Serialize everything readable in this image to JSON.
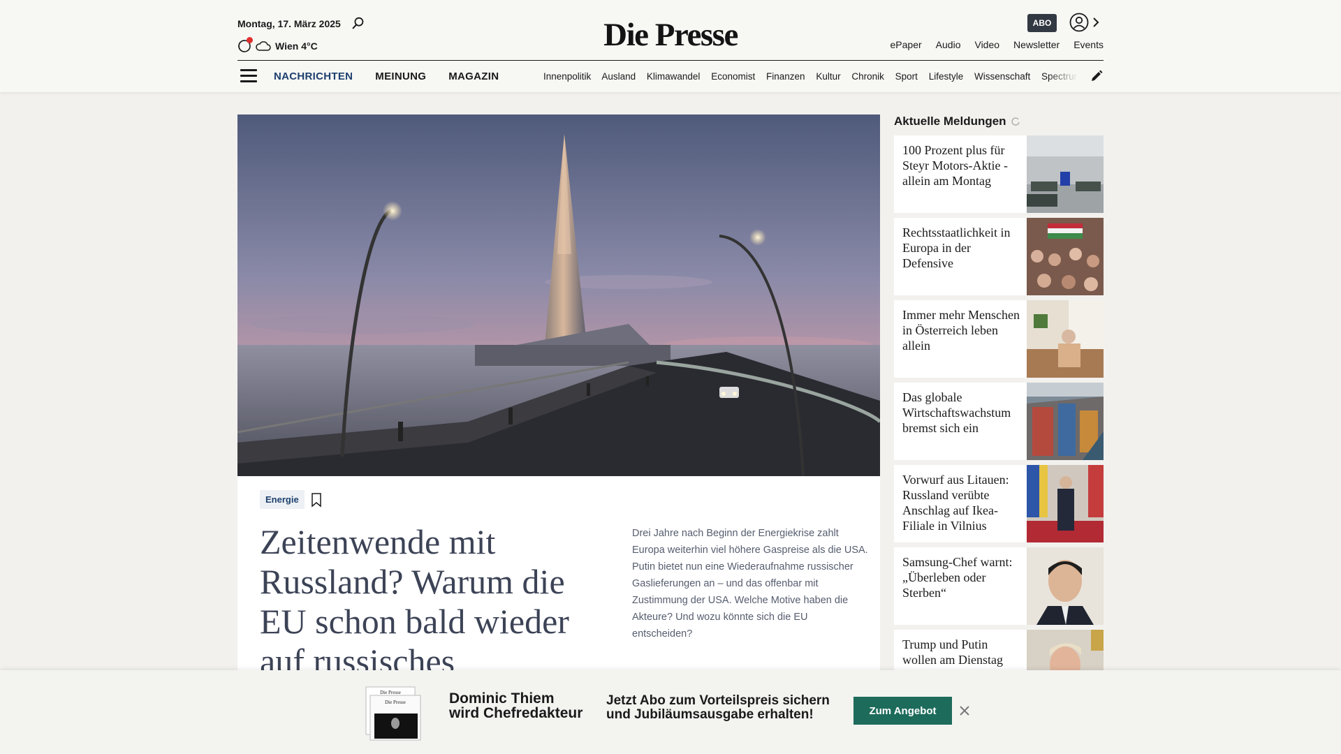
{
  "header": {
    "date": "Montag, 17. März 2025",
    "weather": "Wien 4°C",
    "logo": "Die Presse",
    "abo_label": "ABO",
    "links": [
      "ePaper",
      "Audio",
      "Video",
      "Newsletter",
      "Events"
    ],
    "main_nav": [
      "NACHRICHTEN",
      "MEINUNG",
      "MAGAZIN"
    ],
    "sub_nav": [
      "Innenpolitik",
      "Ausland",
      "Klimawandel",
      "Economist",
      "Finanzen",
      "Kultur",
      "Chronik",
      "Sport",
      "Lifestyle",
      "Wissenschaft",
      "Spectrum"
    ]
  },
  "article": {
    "tag": "Energie",
    "headline": "Zeitenwende mit Russland? Warum die EU schon bald wieder auf russisches",
    "teaser": "Drei Jahre nach Beginn der Energiekrise zahlt Europa weiterhin viel höhere Gaspreise als die USA. Putin bietet nun eine Wiederaufnahme russischer Gaslieferungen an – und das offenbar mit Zustimmung der USA. Welche Motive haben die Akteure? Und wozu könnte sich die EU entscheiden?"
  },
  "sidebar": {
    "title": "Aktuelle Meldungen",
    "items": [
      {
        "text": "100 Prozent plus für Steyr Motors-Aktie - allein am Montag"
      },
      {
        "text": "Rechtsstaatlichkeit in Europa in der Defensive"
      },
      {
        "text": "Immer mehr Menschen in Österreich leben allein"
      },
      {
        "text": "Das globale Wirtschaftswachstum bremst sich ein"
      },
      {
        "text": "Vorwurf aus Litauen: Russland verübte Anschlag auf Ikea-Filiale in Vilnius"
      },
      {
        "text": "Samsung-Chef warnt: „Überleben oder Sterben“"
      },
      {
        "text": "Trump und Putin wollen am Dienstag telefonieren"
      }
    ]
  },
  "promo": {
    "name_line1": "Dominic Thiem",
    "name_line2": "wird Chefredakteur",
    "offer_line1": "Jetzt Abo zum Vorteilspreis sichern",
    "offer_line2": "und Jubiläumsausgabe erhalten!",
    "button": "Zum Angebot",
    "paper_logo": "Die Presse"
  },
  "colors": {
    "nav_active": "#1c3f6e",
    "promo_button": "#1d6b5b",
    "headline": "#3c4356"
  }
}
